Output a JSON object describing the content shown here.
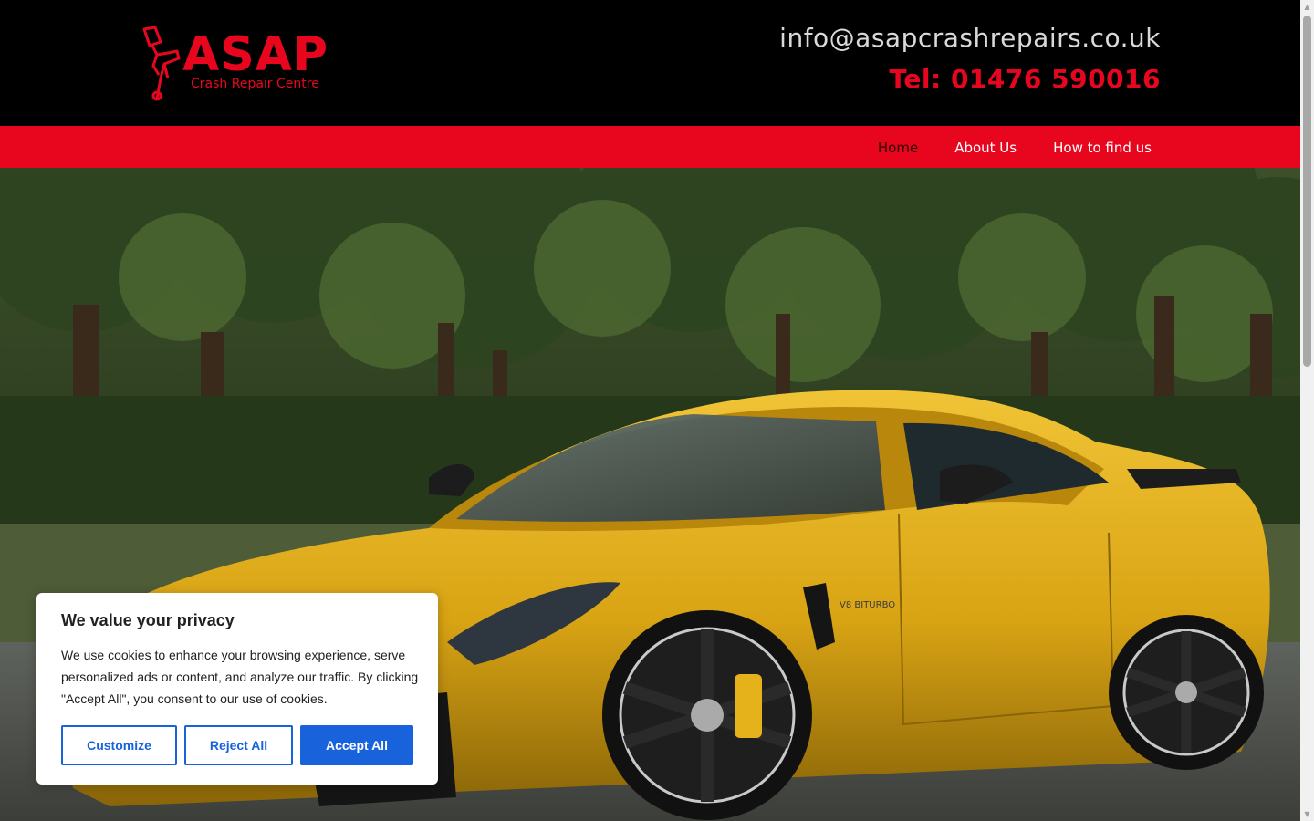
{
  "header": {
    "logo_word": "ASAP",
    "logo_tagline": "Crash Repair Centre",
    "email": "info@asapcrashrepairs.co.uk",
    "tel": "Tel: 01476 590016"
  },
  "nav": {
    "items": [
      {
        "label": "Home",
        "active": true
      },
      {
        "label": "About Us"
      },
      {
        "label": "How to find us"
      }
    ]
  },
  "hero": {
    "badge": "V8 BITURBO"
  },
  "cookie": {
    "title": "We value your privacy",
    "body": "We use cookies to enhance your browsing experience, serve personalized ads or content, and analyze our traffic. By clicking \"Accept All\", you consent to our use of cookies.",
    "customize_label": "Customize",
    "reject_label": "Reject All",
    "accept_label": "Accept All"
  },
  "colors": {
    "brand_red": "#e8061f",
    "header_bg": "#000000",
    "cookie_blue": "#1863dc",
    "car_yellow": "#e4b21a"
  }
}
